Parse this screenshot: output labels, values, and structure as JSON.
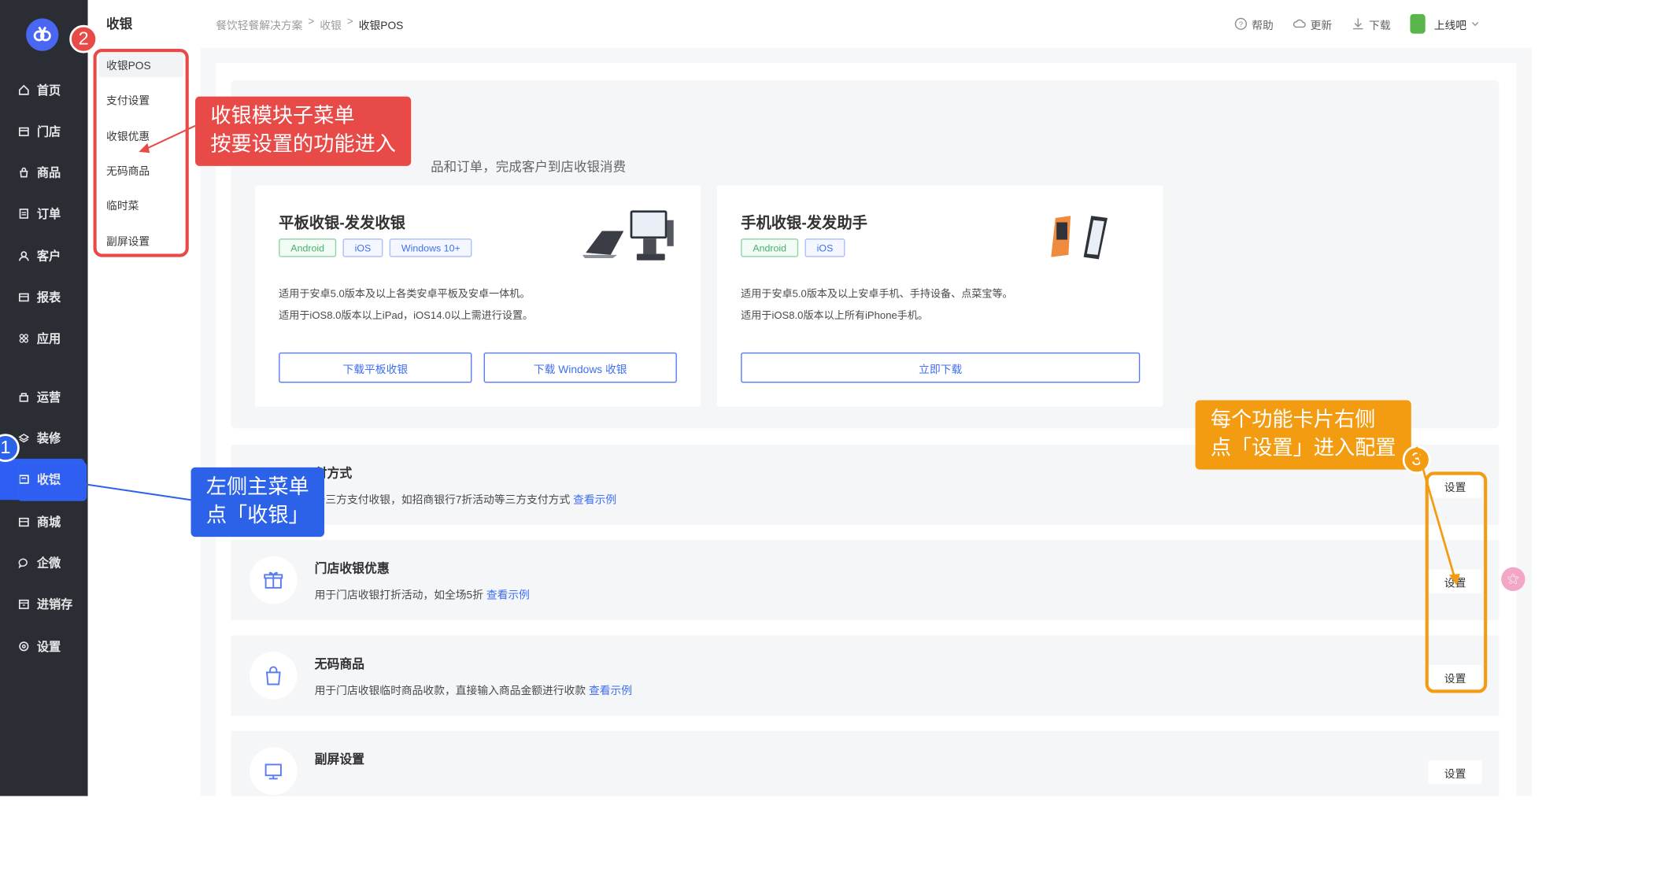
{
  "sidebar": {
    "items": [
      {
        "label": "首页",
        "icon": "home-icon"
      },
      {
        "label": "门店",
        "icon": "store-icon"
      },
      {
        "label": "商品",
        "icon": "goods-icon"
      },
      {
        "label": "订单",
        "icon": "order-icon"
      },
      {
        "label": "客户",
        "icon": "customer-icon"
      },
      {
        "label": "报表",
        "icon": "report-icon"
      },
      {
        "label": "应用",
        "icon": "apps-icon"
      },
      {
        "label": "运营",
        "icon": "operation-icon"
      },
      {
        "label": "装修",
        "icon": "decoration-icon"
      },
      {
        "label": "收银",
        "icon": "cashier-icon"
      },
      {
        "label": "商城",
        "icon": "mall-icon"
      },
      {
        "label": "企微",
        "icon": "wecom-icon"
      },
      {
        "label": "进销存",
        "icon": "inventory-icon"
      },
      {
        "label": "设置",
        "icon": "settings-icon"
      }
    ],
    "active": "收银"
  },
  "submenu": {
    "title": "收银",
    "items": [
      "收银POS",
      "支付设置",
      "收银优惠",
      "无码商品",
      "临时菜",
      "副屏设置"
    ],
    "active": "收银POS"
  },
  "breadcrumb": [
    "餐饮轻餐解决方案",
    "收银",
    "收银POS"
  ],
  "topbar": {
    "help": "帮助",
    "update": "更新",
    "download": "下载",
    "shop_name": "上线吧"
  },
  "hero": {
    "desc_partial": "品和订单，完成客户到店收银消费"
  },
  "cards": [
    {
      "title": "平板收银-发发收银",
      "tags": [
        "Android",
        "iOS",
        "Windows 10+"
      ],
      "line1": "适用于安卓5.0版本及以上各类安卓平板及安卓一体机。",
      "line2": "适用于iOS8.0版本以上iPad，iOS14.0以上需进行设置。",
      "buttons": [
        "下载平板收银",
        "下载 Windows 收银"
      ]
    },
    {
      "title": "手机收银-发发助手",
      "tags": [
        "Android",
        "iOS"
      ],
      "line1": "适用于安卓5.0版本及以上安卓手机、手持设备、点菜宝等。",
      "line2": "适用于iOS8.0版本以上所有iPhone手机。",
      "buttons": [
        "立即下载"
      ]
    }
  ],
  "features": [
    {
      "title": "付方式",
      "desc": "于三方支付收银，如招商银行7折活动等三方支付方式",
      "link": "查看示例",
      "button": "设置"
    },
    {
      "title": "门店收银优惠",
      "desc": "用于门店收银打折活动，如全场5折",
      "link": "查看示例",
      "button": "设置"
    },
    {
      "title": "无码商品",
      "desc": "用于门店收银临时商品收款，直接输入商品金额进行收款",
      "link": "查看示例",
      "button": "设置"
    },
    {
      "title": "副屏设置",
      "desc": "",
      "link": "",
      "button": "设置"
    }
  ],
  "annotations": {
    "badge1": "1",
    "badge2": "2",
    "badge3": "3",
    "red_line1": "收银模块子菜单",
    "red_line2": "按要设置的功能进入",
    "blue_line1": "左侧主菜单",
    "blue_line2": "点「收银」",
    "orange_line1": "每个功能卡片右侧",
    "orange_line2": "点「设置」进入配置"
  },
  "colors": {
    "sidebar_bg": "#2b2d34",
    "primary": "#3f6ff2",
    "annotation_red": "#e84a48",
    "annotation_blue": "#2c62e8",
    "annotation_orange": "#f39c12"
  }
}
